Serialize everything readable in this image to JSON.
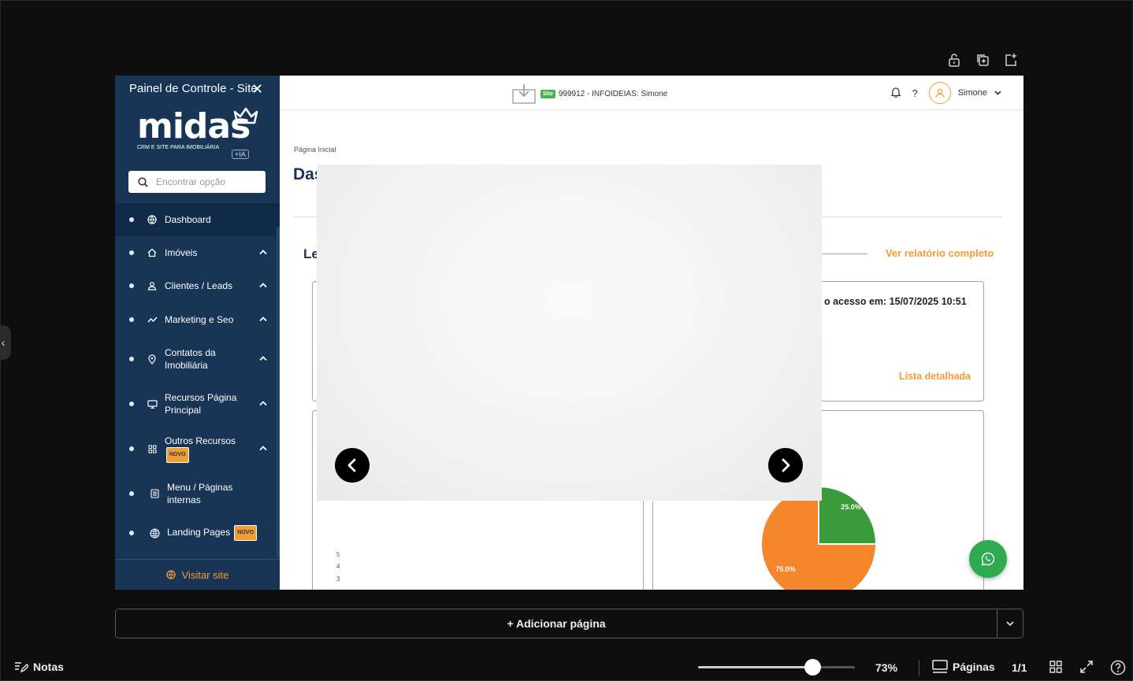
{
  "editor": {
    "top_tools": [
      "lock-icon",
      "duplicate-page-icon",
      "add-page-icon"
    ],
    "add_page_label": "+ Adicionar página",
    "notes_label": "Notas",
    "zoom": "73%",
    "zoom_level": 0.73,
    "pages_label": "Páginas",
    "page_indicator": "1/1"
  },
  "sidebar": {
    "title": "Painel de Controle - Site",
    "logo_text": "midas",
    "logo_subtitle": "CRM E SITE PARA IMOBILIÁRIA",
    "logo_badge": "+IA",
    "search_placeholder": "Encontrar opção",
    "items": [
      {
        "label": "Dashboard",
        "icon": "globe-icon"
      },
      {
        "label": "Imóveis",
        "icon": "home-icon"
      },
      {
        "label": "Clientes / Leads",
        "icon": "user-icon"
      },
      {
        "label": "Marketing e Seo",
        "icon": "trend-icon"
      },
      {
        "label": "Contatos da",
        "label2": "Imobiliária",
        "icon": "location-pin-icon"
      },
      {
        "label": "Recursos Página",
        "label2": "Principal",
        "icon": "monitor-icon"
      },
      {
        "label": "Outros Recursos",
        "badge": "NOVO",
        "icon": "grid-icon"
      },
      {
        "label": "Menu / Páginas",
        "label2": "internas",
        "icon": "document-icon"
      },
      {
        "label": "Landing Pages",
        "badge": "NOVO",
        "icon": "globe-outline-icon"
      }
    ],
    "visit_label": "Visitar site"
  },
  "header": {
    "site_tag": "Site",
    "account": "999912 - INFOIDEIAS: Simone",
    "help": "?",
    "user": "Simone"
  },
  "content": {
    "breadcrumb": "Página Inicial",
    "title_partial": "Das",
    "section_partial": "Le",
    "full_report": "Ver relatório completo",
    "last_access": "o acesso em: 15/07/2025 10:51",
    "detailed_list": "Lista detalhada",
    "y_ticks": [
      "5",
      "4",
      "3"
    ]
  },
  "chart_data": {
    "type": "pie",
    "values": [
      25.0,
      75.0
    ],
    "labels": [
      "25.0%",
      "75.0%"
    ],
    "colors": [
      "#3a9b3a",
      "#f5862b"
    ]
  }
}
